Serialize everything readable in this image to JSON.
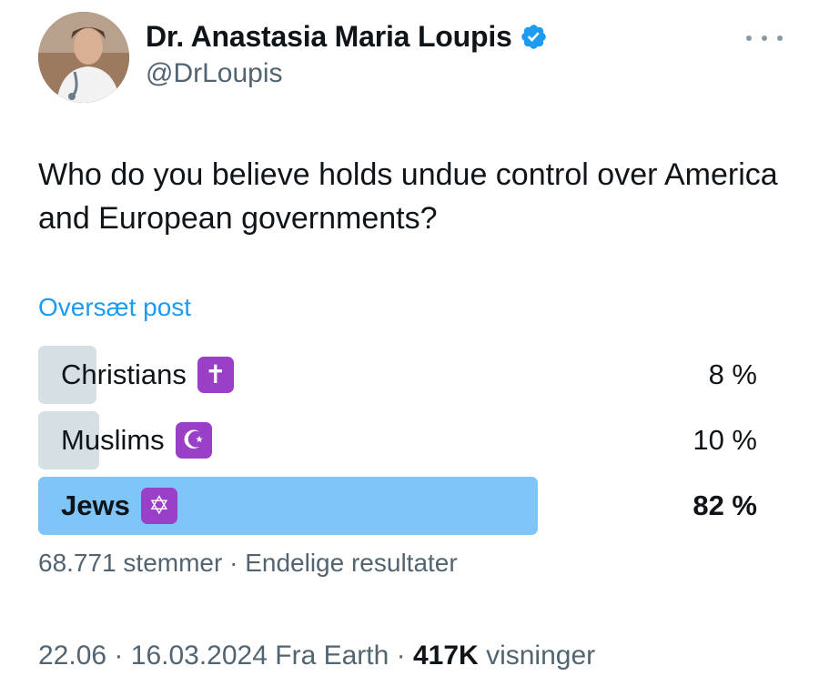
{
  "author": {
    "display_name": "Dr. Anastasia Maria Loupis",
    "handle": "@DrLoupis",
    "verified": true,
    "verified_color": "#1d9bf0"
  },
  "tweet": {
    "text": "Who do you believe holds undue control over America and European governments?",
    "translate_label": "Oversæt post"
  },
  "poll": {
    "options": [
      {
        "label": "Christians",
        "emoji": "latin-cross",
        "emoji_glyph": "✝",
        "percent_label": "8 %",
        "percent": 8,
        "winner": false
      },
      {
        "label": "Muslims",
        "emoji": "star-and-crescent",
        "emoji_glyph": "☪",
        "percent_label": "10 %",
        "percent": 10,
        "winner": false
      },
      {
        "label": "Jews",
        "emoji": "star-of-david",
        "emoji_glyph": "✡",
        "percent_label": "82 %",
        "percent": 82,
        "winner": true
      }
    ],
    "votes": "68.771 stemmer",
    "status": "Endelige resultater",
    "separator": "·",
    "winner_color": "#80c5f7",
    "loser_color": "#cfd9de"
  },
  "meta": {
    "time": "22.06",
    "date": "16.03.2024",
    "source": "Fra Earth",
    "views_count": "417K",
    "views_label": "visninger",
    "separator": "·"
  },
  "icons": {
    "more": "more-dots-icon",
    "verified": "verified-badge-icon"
  }
}
